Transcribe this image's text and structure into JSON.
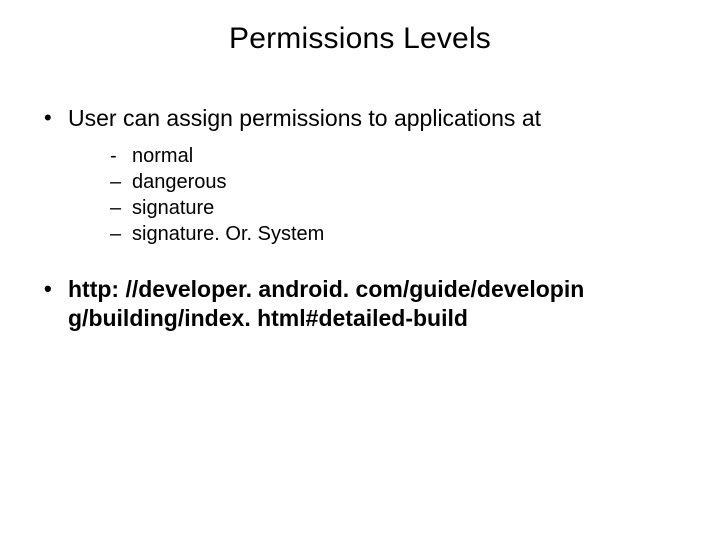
{
  "title": "Permissions Levels",
  "bullets": {
    "intro": "User can assign permissions to  applications at",
    "sub": [
      {
        "marker": "-",
        "text": "normal"
      },
      {
        "marker": "–",
        "text": "dangerous"
      },
      {
        "marker": "–",
        "text": "signature"
      },
      {
        "marker": "–",
        "text": "signature. Or. System"
      }
    ],
    "link": "http: //developer. android. com/guide/developin g/building/index. html#detailed-build"
  }
}
